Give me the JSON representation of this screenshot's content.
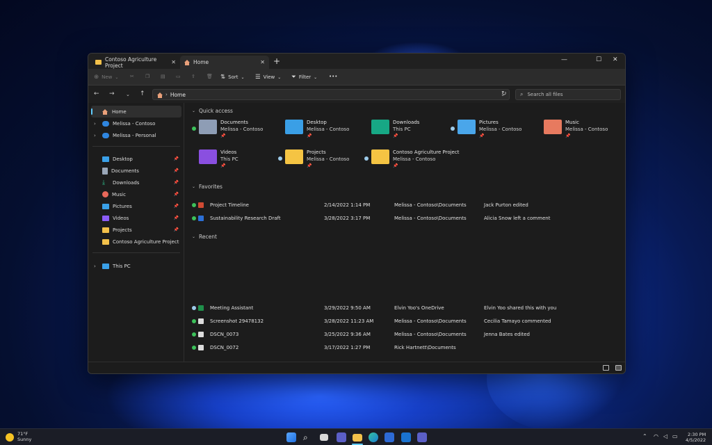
{
  "tabs": [
    {
      "label": "Contoso Agriculture Project",
      "icon": "folder-icon"
    },
    {
      "label": "Home",
      "icon": "home-icon",
      "active": true
    }
  ],
  "window_controls": {
    "minimize": "—",
    "maximize": "☐",
    "close": "✕",
    "new_tab": "+"
  },
  "toolbar": {
    "new_label": "New",
    "sort_label": "Sort",
    "view_label": "View",
    "filter_label": "Filter",
    "more_label": "•••"
  },
  "address": {
    "path": "Home",
    "search_placeholder": "Search all files"
  },
  "sidebar": {
    "top": [
      {
        "label": "Home",
        "icon": "home-icon",
        "selected": true
      },
      {
        "label": "Melissa - Contoso",
        "icon": "onedrive-icon"
      },
      {
        "label": "Melissa - Personal",
        "icon": "onedrive-icon"
      }
    ],
    "pinned": [
      {
        "label": "Desktop",
        "icon": "desktop-icon",
        "color": "#3aa0e8"
      },
      {
        "label": "Documents",
        "icon": "documents-icon",
        "color": "#9aa7b8"
      },
      {
        "label": "Downloads",
        "icon": "downloads-icon",
        "color": "#2fc48f"
      },
      {
        "label": "Music",
        "icon": "music-icon",
        "color": "#e8685a"
      },
      {
        "label": "Pictures",
        "icon": "pictures-icon",
        "color": "#3aa0e8"
      },
      {
        "label": "Videos",
        "icon": "videos-icon",
        "color": "#8b5cf6"
      },
      {
        "label": "Projects",
        "icon": "folder-icon",
        "color": "#f2c04a"
      },
      {
        "label": "Contoso Agriculture Project",
        "icon": "folder-icon",
        "color": "#f2c04a"
      }
    ],
    "this_pc": "This PC"
  },
  "sections": {
    "quick_access": "Quick access",
    "favorites": "Favorites",
    "recent": "Recent"
  },
  "quick_access": [
    {
      "name": "Documents",
      "sub": "Melissa - Contoso",
      "color": "#8e9db5",
      "status": "#3cc15a"
    },
    {
      "name": "Desktop",
      "sub": "Melissa - Contoso",
      "color": "#3a9fe6",
      "status": ""
    },
    {
      "name": "Downloads",
      "sub": "This PC",
      "color": "#17a885",
      "status": ""
    },
    {
      "name": "Pictures",
      "sub": "Melissa - Contoso",
      "color": "#4aa6ea",
      "status": "#9ccae9"
    },
    {
      "name": "Music",
      "sub": "Melissa - Contoso",
      "color": "#e77a5f",
      "status": ""
    },
    {
      "name": "Videos",
      "sub": "This PC",
      "color": "#8a4fe0",
      "status": ""
    },
    {
      "name": "Projects",
      "sub": "Melissa - Contoso",
      "color": "#f5c443",
      "status": "#9ccae9"
    },
    {
      "name": "Contoso Agriculture Project",
      "sub": "Melissa - Contoso",
      "color": "#f5c443",
      "status": "#9ccae9"
    }
  ],
  "favorites": [
    {
      "name": "Project Timeline",
      "date": "2/14/2022 1:14 PM",
      "location": "Melissa - Contoso\\Documents",
      "activity": "Jack Purton edited",
      "icon_color": "#d04a33"
    },
    {
      "name": "Sustainability Research Draft",
      "date": "3/28/2022 3:17 PM",
      "location": "Melissa - Contoso\\Documents",
      "activity": "Alicia Snow left a comment",
      "icon_color": "#2b6fd6"
    }
  ],
  "recent": [
    {
      "name": "Meeting Assistant",
      "date": "3/29/2022 9:50 AM",
      "location": "Elvin Yoo's OneDrive",
      "activity": "Elvin Yoo shared this with you",
      "icon_color": "#1f8f4a",
      "status": "#9ccae9"
    },
    {
      "name": "Screenshot 29478132",
      "date": "3/28/2022 11:23 AM",
      "location": "Melissa - Contoso\\Documents",
      "activity": "Cecilia Tamayo commented",
      "icon_color": "#dcdcdc",
      "status": "#3cc15a"
    },
    {
      "name": "DSCN_0073",
      "date": "3/25/2022 9:36 AM",
      "location": "Melissa - Contoso\\Documents",
      "activity": "Jenna Bates edited",
      "icon_color": "#dcdcdc",
      "status": "#3cc15a"
    },
    {
      "name": "DSCN_0072",
      "date": "3/17/2022 1:27 PM",
      "location": "Rick Hartnett\\Documents",
      "activity": "",
      "icon_color": "#dcdcdc",
      "status": "#3cc15a"
    }
  ],
  "taskbar": {
    "weather_temp": "71°F",
    "weather_desc": "Sunny",
    "time": "2:30 PM",
    "date": "4/5/2022"
  },
  "colors": {
    "accent": "#60cdff",
    "window_bg": "#1c1c1c",
    "toolbar_bg": "#2c2c2c"
  }
}
